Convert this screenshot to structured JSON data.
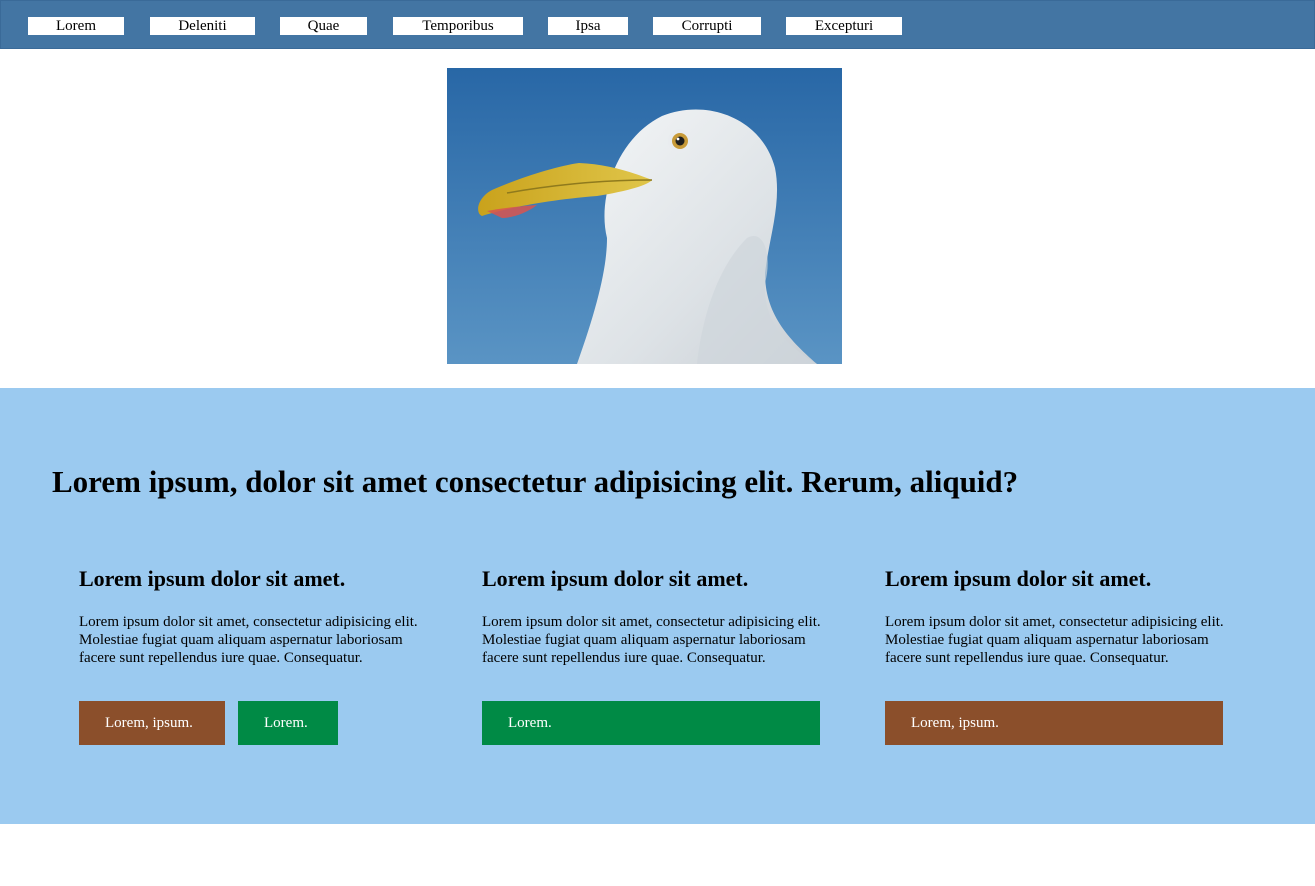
{
  "nav": {
    "items": [
      "Lorem",
      "Deleniti",
      "Quae",
      "Temporibus",
      "Ipsa",
      "Corrupti",
      "Excepturi"
    ]
  },
  "hero": {
    "icon": "seagull-photo"
  },
  "section": {
    "title": "Lorem ipsum, dolor sit amet consectetur adipisicing elit. Rerum, aliquid?",
    "cards": [
      {
        "title": "Lorem ipsum dolor sit amet.",
        "text": "Lorem ipsum dolor sit amet, consectetur adipisicing elit. Molestiae fugiat quam aliquam aspernatur laboriosam facere sunt repellendus iure quae. Consequatur.",
        "buttons": [
          "Lorem, ipsum.",
          "Lorem."
        ]
      },
      {
        "title": "Lorem ipsum dolor sit amet.",
        "text": "Lorem ipsum dolor sit amet, consectetur adipisicing elit. Molestiae fugiat quam aliquam aspernatur laboriosam facere sunt repellendus iure quae. Consequatur.",
        "buttons": [
          "Lorem."
        ]
      },
      {
        "title": "Lorem ipsum dolor sit amet.",
        "text": "Lorem ipsum dolor sit amet, consectetur adipisicing elit. Molestiae fugiat quam aliquam aspernatur laboriosam facere sunt repellendus iure quae. Consequatur.",
        "buttons": [
          "Lorem, ipsum."
        ]
      }
    ]
  },
  "colors": {
    "nav_bg": "#4375a3",
    "band_bg": "#9bcaf0",
    "button_brown": "#8b4f2b",
    "button_green": "#008a45"
  }
}
